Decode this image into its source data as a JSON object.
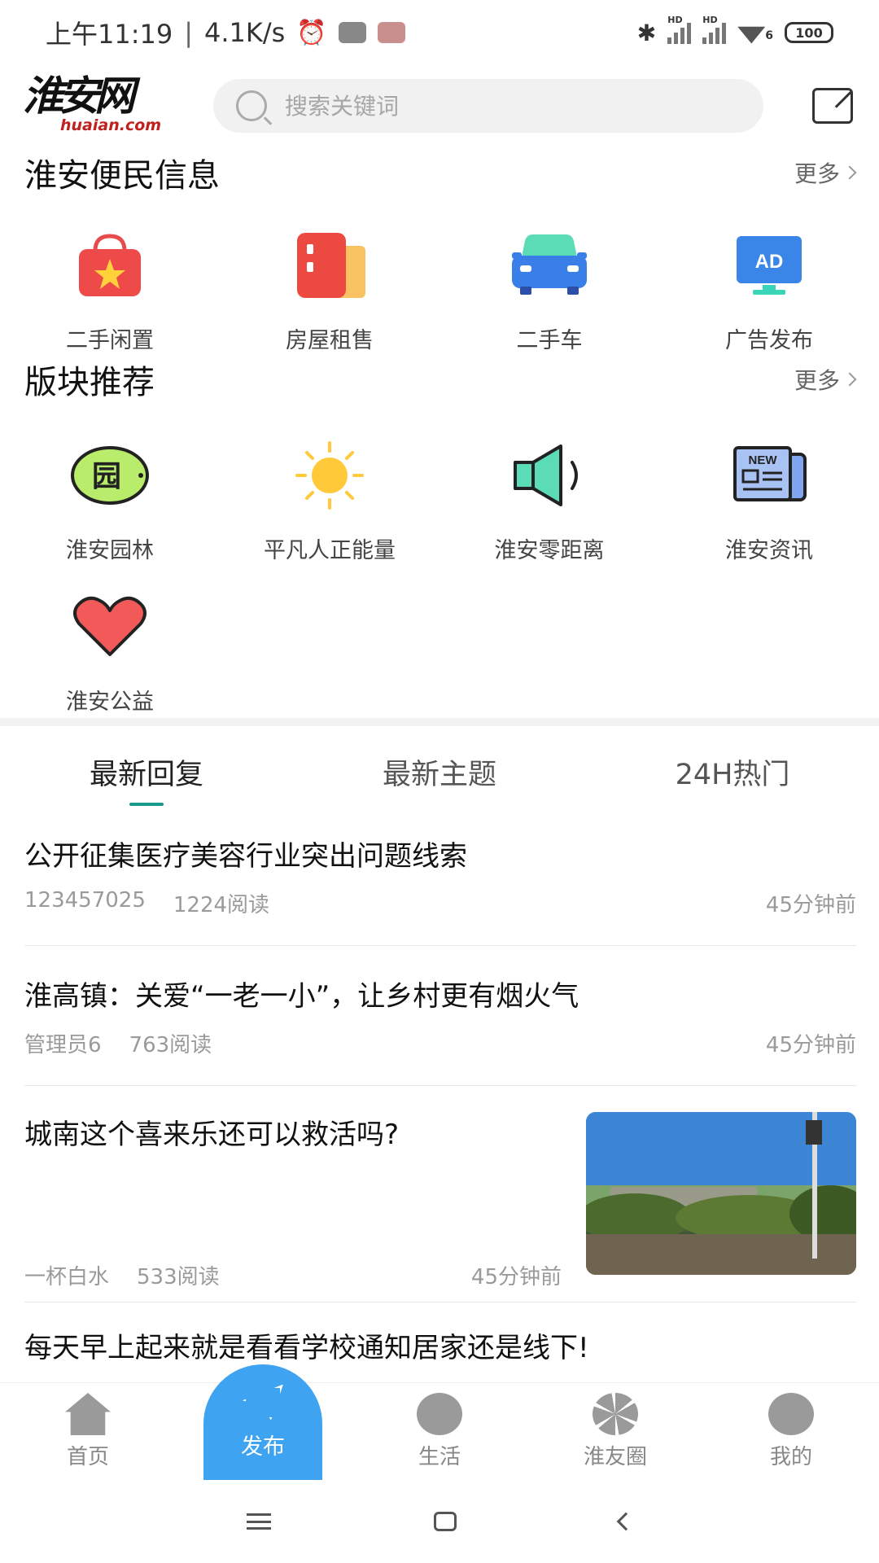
{
  "status_bar": {
    "time": "上午11:19",
    "speed": "4.1K/s",
    "battery": "100",
    "hd_label": "HD",
    "wifi_label": "6"
  },
  "header": {
    "logo_text": "淮安网",
    "logo_domain": "huaian.com",
    "search_placeholder": "搜索关键词"
  },
  "services": {
    "title": "淮安便民信息",
    "more": "更多",
    "items": [
      {
        "label": "二手闲置",
        "icon": "shopping-bag-icon"
      },
      {
        "label": "房屋租售",
        "icon": "building-icon"
      },
      {
        "label": "二手车",
        "icon": "car-icon"
      },
      {
        "label": "广告发布",
        "icon": "ad-icon",
        "badge": "AD"
      }
    ]
  },
  "boards": {
    "title": "版块推荐",
    "more": "更多",
    "items": [
      {
        "label": "淮安园林",
        "icon": "garden-icon",
        "glyph": "园"
      },
      {
        "label": "平凡人正能量",
        "icon": "sun-icon"
      },
      {
        "label": "淮安零距离",
        "icon": "speaker-icon"
      },
      {
        "label": "淮安资讯",
        "icon": "newspaper-icon",
        "badge": "NEW"
      },
      {
        "label": "淮安公益",
        "icon": "heart-icon"
      }
    ]
  },
  "tabs": [
    "最新回复",
    "最新主题",
    "24H热门"
  ],
  "posts": [
    {
      "title": "公开征集医疗美容行业突出问题线索",
      "author": "123457025",
      "reads": "1224阅读",
      "time": "45分钟前"
    },
    {
      "title": "淮高镇：关爱“一老一小”，让乡村更有烟火气",
      "author": "管理员6",
      "reads": "763阅读",
      "time": "45分钟前"
    },
    {
      "title": "城南这个喜来乐还可以救活吗?",
      "author": "一杯白水",
      "reads": "533阅读",
      "time": "45分钟前"
    },
    {
      "title": "每天早上起来就是看看学校通知居家还是线下!"
    }
  ],
  "bottom_nav": {
    "home": "首页",
    "publish": "发布",
    "life": "生活",
    "circle": "淮友圈",
    "mine": "我的"
  }
}
